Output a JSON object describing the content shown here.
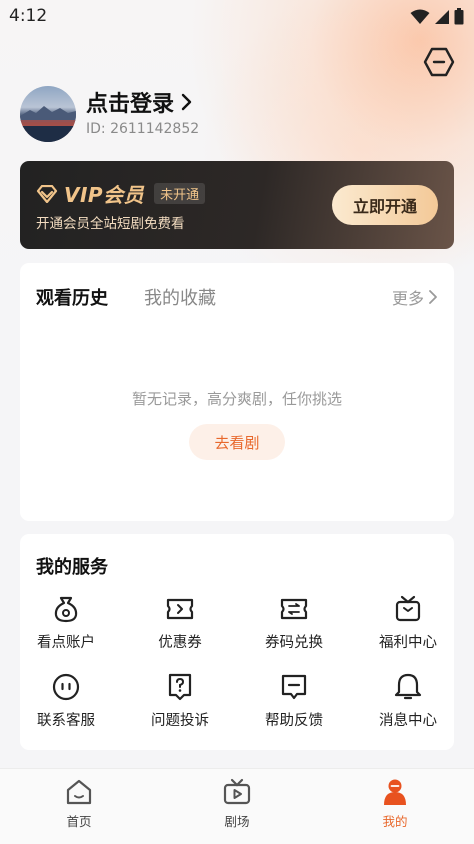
{
  "status_bar": {
    "time": "4:12"
  },
  "header": {
    "login_label": "点击登录",
    "user_id": "ID: 2611142852"
  },
  "vip": {
    "title": "VIP会员",
    "badge": "未开通",
    "subtitle": "开通会员全站短剧免费看",
    "button_label": "立即开通",
    "accent_color": "#f1c48a"
  },
  "history": {
    "tabs": [
      "观看历史",
      "我的收藏"
    ],
    "more_label": "更多",
    "empty_text": "暂无记录，高分爽剧，任你挑选",
    "goto_button": "去看剧",
    "accent_color": "#e8682c"
  },
  "services": {
    "title": "我的服务",
    "items": [
      {
        "label": "看点账户",
        "icon": "wallet-bag-icon"
      },
      {
        "label": "优惠券",
        "icon": "coupon-icon"
      },
      {
        "label": "券码兑换",
        "icon": "exchange-icon"
      },
      {
        "label": "福利中心",
        "icon": "gift-tv-icon"
      },
      {
        "label": "联系客服",
        "icon": "customer-service-icon"
      },
      {
        "label": "问题投诉",
        "icon": "complaint-icon"
      },
      {
        "label": "帮助反馈",
        "icon": "feedback-icon"
      },
      {
        "label": "消息中心",
        "icon": "bell-icon"
      }
    ]
  },
  "bottom_nav": {
    "items": [
      {
        "label": "首页",
        "icon": "home-icon"
      },
      {
        "label": "剧场",
        "icon": "theater-icon"
      },
      {
        "label": "我的",
        "icon": "profile-icon"
      }
    ],
    "active_index": 2
  }
}
